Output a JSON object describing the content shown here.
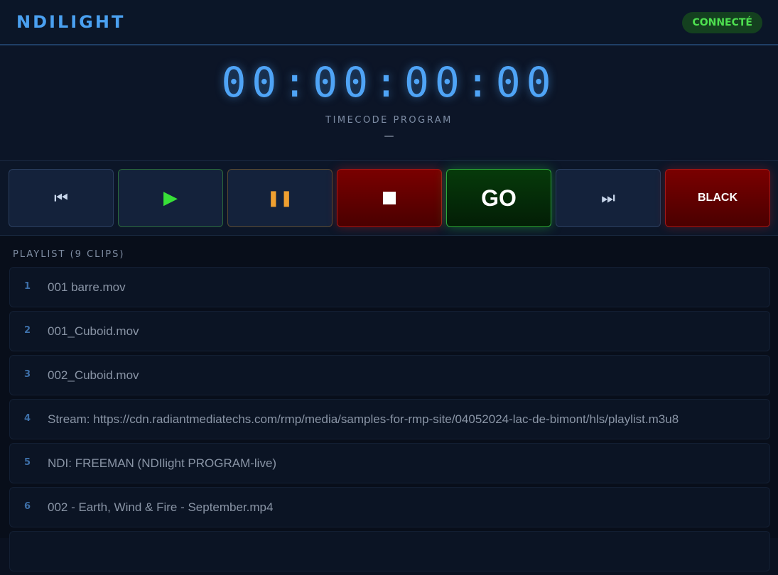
{
  "header": {
    "brand": "NDILIGHT",
    "status": "CONNECTÉ"
  },
  "timecode": {
    "value": "00:00:00:00",
    "label": "TIMECODE PROGRAM",
    "sub": "—"
  },
  "controls": {
    "prev_icon": "⏮",
    "play_icon": "▶",
    "pause_icon": "❚❚",
    "go_label": "GO",
    "next_icon": "⏭",
    "black_label": "BLACK"
  },
  "playlist": {
    "heading": "PLAYLIST (9 CLIPS)",
    "items": [
      {
        "num": "1",
        "name": "001 barre.mov"
      },
      {
        "num": "2",
        "name": "001_Cuboid.mov"
      },
      {
        "num": "3",
        "name": "002_Cuboid.mov"
      },
      {
        "num": "4",
        "name": "Stream: https://cdn.radiantmediatechs.com/rmp/media/samples-for-rmp-site/04052024-lac-de-bimont/hls/playlist.m3u8"
      },
      {
        "num": "5",
        "name": "NDI: FREEMAN (NDIlight PROGRAM-live)"
      },
      {
        "num": "6",
        "name": "002 - Earth, Wind & Fire - September.mp4"
      },
      {
        "num": "",
        "name": ""
      }
    ]
  },
  "colors": {
    "accent": "#4aa0f0",
    "status_bg": "#14401f",
    "status_text": "#4ee050",
    "stop_red": "#7a0000",
    "go_green": "#063a0a"
  }
}
